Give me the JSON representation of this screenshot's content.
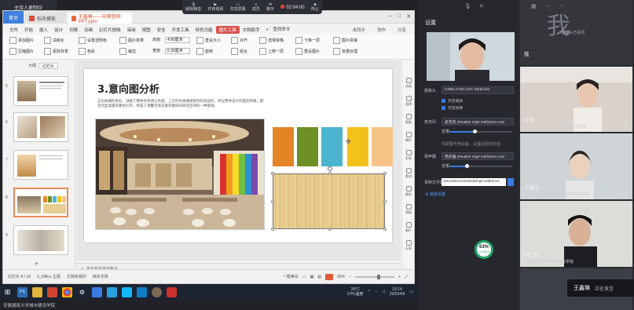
{
  "presenter_label": "主持人更制中",
  "app": {
    "home_tab": "首页",
    "template_tab": "稻壳模板",
    "file_tab": "王鑫琳——中期答辩PPT.pptx",
    "menu": [
      "文件",
      "开始",
      "插入",
      "设计",
      "切换",
      "动画",
      "幻灯片放映",
      "审阅",
      "视图",
      "安全",
      "开发工具",
      "特色功能",
      "图片工具",
      "文档助手"
    ],
    "menu_active": "图片工具",
    "menu_right": [
      "未同步",
      "协作",
      "分享"
    ],
    "search": "查找命令",
    "ribbon": {
      "height_label": "高度:",
      "height_value": "4.80厘米",
      "width_label": "宽度:",
      "width_value": "6.36厘米",
      "items": [
        "添加图片",
        "压缩图片",
        "清晰化",
        "抠除背景",
        "设置透明色",
        "色彩",
        "图片效果",
        "裁剪",
        "重设大小",
        "旋转",
        "对齐",
        "组合",
        "选择窗格",
        "上移一层",
        "下移一层",
        "重设图片",
        "图片拼接",
        "批量处理"
      ]
    },
    "pane_tabs": {
      "outline": "大纲",
      "slides": "幻灯片"
    },
    "thumb_numbers": [
      "5",
      "6",
      "7",
      "8",
      "9"
    ],
    "slide": {
      "title": "3.意向图分析",
      "body": "五彩斑斓的色彩，减缓了整体的单调之色感。上方的木质横梁配饰形成弧形，呼应整体设计的圆润风格，配合造型墙面及暖色灯带，构成了温馨活泼又富有趣味的阅读空间的一种意境。"
    },
    "swatch_colors": [
      "#e38526",
      "#6d9124",
      "#4db4d0",
      "#f2c21a",
      "#f6c487"
    ],
    "notes_placeholder": "单击此处添加备注",
    "status": {
      "slide_counter": "幻灯片 8 / 18",
      "theme": "3_Office 主题",
      "protect": "文档未保护",
      "fonts_missing": "缺失字体",
      "beautify": "一键美化",
      "zoom": "90%"
    },
    "side_items": [
      "动画",
      "选择",
      "智能",
      "稿件",
      "形状",
      "素材",
      "属性",
      "帮助",
      "图片",
      "分享"
    ]
  },
  "meeting_toolbar": {
    "items": [
      "解除静音",
      "开启视频",
      "共享屏幕",
      "成员",
      "聊天",
      "停止"
    ],
    "rec_time": "02:04:00"
  },
  "taskbar": {
    "apps": [
      "PS",
      "文件",
      "WPS",
      "Chrome",
      "设置",
      "会议",
      "画图",
      "腾讯",
      "Edge",
      "其他",
      "PDF"
    ],
    "weather": "26°C",
    "cpu": "CPU温度",
    "time": "15:14",
    "date": "2020/4/9"
  },
  "bottom_caption": "安徽建筑大学城市建设学院",
  "network": {
    "percent": "63%",
    "speed": "↓0.2K/s"
  },
  "settings": {
    "title": "设置",
    "camera_label": "摄像头",
    "camera_value": "USB2.0 HD UVC WebCam",
    "camera_opts": [
      "开启美颜",
      "开启镜像"
    ],
    "mic_label": "麦克风",
    "mic_value": "麦克风 (Realtek High Definition Aud",
    "volume_label": "音量",
    "hint": "仅配置可用设备，设置后即刻生效",
    "speaker_label": "扬声器",
    "speaker_value": "扬声器 (Realtek High Definition Aud",
    "record_label": "录制文件路径",
    "record_value": "ADIUS\\Documents\\DingConference",
    "advanced": "高级设置"
  },
  "participants": [
    {
      "name": "我",
      "sub": "",
      "avatar": "我"
    },
    {
      "name": "岑琦",
      "sub": "安徽建筑大学城市建设学院"
    },
    {
      "name": "方康艺",
      "sub": "安徽建筑大学城市建设学院"
    },
    {
      "name": "何仁旺",
      "sub": "安徽建筑大学城市建设学院"
    }
  ],
  "speaker_badge": {
    "name": "王鑫琳",
    "status": "正在发言"
  },
  "top_label": "摄像头已关闭"
}
